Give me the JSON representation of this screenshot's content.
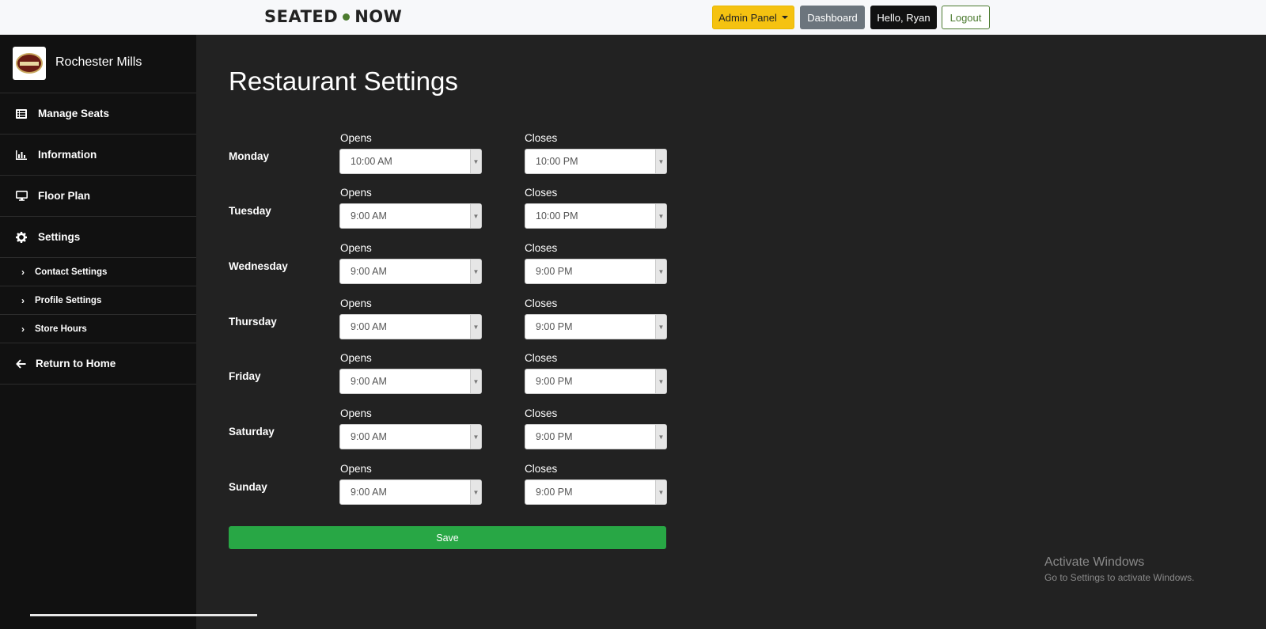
{
  "brand": {
    "left": "SEATED",
    "right": "NOW"
  },
  "topnav": {
    "admin_panel": "Admin Panel",
    "dashboard": "Dashboard",
    "greeting": "Hello, Ryan",
    "logout": "Logout"
  },
  "sidebar": {
    "restaurant_name": "Rochester Mills",
    "items": [
      {
        "label": "Manage Seats",
        "icon": "list-icon"
      },
      {
        "label": "Information",
        "icon": "bar-chart-icon"
      },
      {
        "label": "Floor Plan",
        "icon": "monitor-icon"
      },
      {
        "label": "Settings",
        "icon": "gear-icon"
      }
    ],
    "sub_items": [
      {
        "label": "Contact Settings",
        "icon": "chevron-right-icon"
      },
      {
        "label": "Profile Settings",
        "icon": "chevron-right-icon"
      },
      {
        "label": "Store Hours",
        "icon": "chevron-right-icon"
      }
    ],
    "return_home": {
      "label": "Return to Home",
      "icon": "arrow-left-icon"
    }
  },
  "main": {
    "title": "Restaurant Settings",
    "opens_label": "Opens",
    "closes_label": "Closes",
    "days": [
      {
        "day": "Monday",
        "opens": "10:00 AM",
        "closes": "10:00 PM"
      },
      {
        "day": "Tuesday",
        "opens": "9:00 AM",
        "closes": "10:00 PM"
      },
      {
        "day": "Wednesday",
        "opens": "9:00 AM",
        "closes": "9:00 PM"
      },
      {
        "day": "Thursday",
        "opens": "9:00 AM",
        "closes": "9:00 PM"
      },
      {
        "day": "Friday",
        "opens": "9:00 AM",
        "closes": "9:00 PM"
      },
      {
        "day": "Saturday",
        "opens": "9:00 AM",
        "closes": "9:00 PM"
      },
      {
        "day": "Sunday",
        "opens": "9:00 AM",
        "closes": "9:00 PM"
      }
    ],
    "save_label": "Save"
  },
  "watermark": {
    "line1": "Activate Windows",
    "line2": "Go to Settings to activate Windows."
  },
  "colors": {
    "accent_green": "#28a745",
    "admin_yellow": "#f5c211",
    "brand_green": "#4b7a2e"
  }
}
